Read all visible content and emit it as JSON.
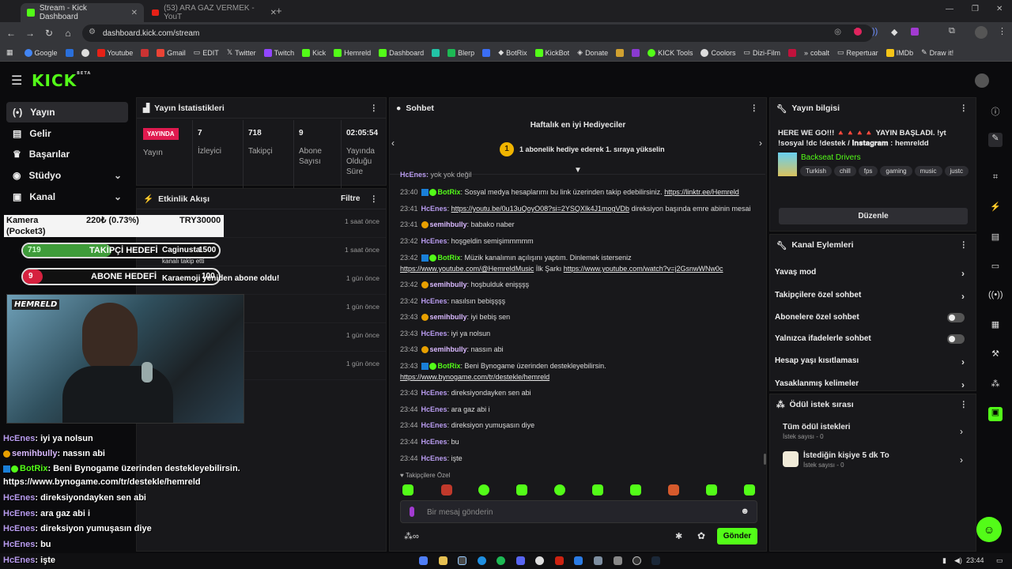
{
  "browser": {
    "tabs": [
      {
        "title": "Stream - Kick Dashboard",
        "active": true
      },
      {
        "title": "(53) ARA GAZ VERMEK - YouT",
        "active": false
      }
    ],
    "url": "dashboard.kick.com/stream",
    "bookmarks": [
      "Google",
      "",
      "",
      "Youtube",
      "",
      "Gmail",
      "EDIT",
      "Twitter",
      "Twitch",
      "Kick",
      "Hemreld",
      "Dashboard",
      "",
      "Blerp",
      "",
      "BotRix",
      "KickBot",
      "Donate",
      "",
      "",
      "KICK Tools",
      "Coolors",
      "Dizi-Film",
      "",
      "cobalt",
      "Repertuar",
      "IMDb",
      "Draw it!"
    ]
  },
  "logo": {
    "text": "KICK",
    "badge": "BETA"
  },
  "sidebar": {
    "items": [
      {
        "label": "Yayın",
        "icon": "broadcast-icon"
      },
      {
        "label": "Gelir",
        "icon": "money-icon"
      },
      {
        "label": "Başarılar",
        "icon": "trophy-icon"
      },
      {
        "label": "Stüdyo",
        "icon": "studio-icon"
      },
      {
        "label": "Kanal",
        "icon": "channel-icon"
      }
    ]
  },
  "stats": {
    "title": "Yayın İstatistikleri",
    "live_badge": "YAYINDA",
    "live_label": "Yayın",
    "viewers": "7",
    "viewers_label": "İzleyici",
    "followers": "718",
    "followers_label": "Takipçi",
    "subs": "9",
    "subs_label": "Abone Sayısı",
    "uptime": "02:05:54",
    "uptime_label": "Yayında Olduğu Süre"
  },
  "events": {
    "title": "Etkinlik Akışı",
    "filter": "Filtre",
    "rows": [
      {
        "time": "1 saat önce"
      },
      {
        "time": "1 saat önce"
      },
      {
        "time": "1 gün önce"
      },
      {
        "time": "1 gün önce"
      },
      {
        "time": "1 gün önce"
      },
      {
        "time": "1 gün önce"
      }
    ]
  },
  "overlay": {
    "donation_name": "Kamera (Pocket3)",
    "donation_amount": "220₺ (0.73%)",
    "donation_goal": "TRY30000",
    "follow_count": "719",
    "follow_goal_label": "TAKİPÇİ HEDEFİ",
    "follow_goal": "1500",
    "follow_user": "Caginusta",
    "follow_text": "kanalı takip etti",
    "sub_count": "9",
    "sub_goal_label": "ABONE HEDEFİ",
    "sub_goal": "100",
    "sub_event": "Karaemoji yeniden abone oldu!",
    "cam_logo": "HEMRELD",
    "chat": [
      {
        "user": "HcEnes",
        "text": ": iyi ya nolsun"
      },
      {
        "user": "semihbully",
        "text": ": nassın abi"
      },
      {
        "user": "BotRix",
        "text": ": Beni Bynogame üzerinden destekleyebilirsin."
      },
      {
        "user": "",
        "text": "https://www.bynogame.com/tr/destekle/hemreld"
      },
      {
        "user": "HcEnes",
        "text": ": direksiyondayken sen abi"
      },
      {
        "user": "HcEnes",
        "text": ": ara gaz abi i"
      },
      {
        "user": "HcEnes",
        "text": ": direksiyon yumuşasın diye"
      },
      {
        "user": "HcEnes",
        "text": ": bu"
      },
      {
        "user": "HcEnes",
        "text": ": işte"
      }
    ]
  },
  "chat": {
    "title": "Sohbet",
    "gifter_title": "Haftalık en iyi Hediyeciler",
    "gifter_text": "1 abonelik hediye ederek 1. sıraya yükselin",
    "gifter_rank": "1",
    "partial_top": "yok yok değil",
    "messages": [
      {
        "time": "23:40",
        "user": "BotRix",
        "text": "Sosyal medya hesaplarımı bu link üzerinden takip edebilirsiniz. ",
        "link": "https://linktr.ee/Hemreld",
        "type": "bot"
      },
      {
        "time": "23:41",
        "user": "HcEnes",
        "text": "",
        "link": "https://youtu.be/0u13uQoyO08?si=2YSQXlk4J1mogVDb",
        "tail": " direksiyon başında emre abinin mesai",
        "type": "hc"
      },
      {
        "time": "23:41",
        "user": "semihbully",
        "text": "babako naber",
        "type": "sb"
      },
      {
        "time": "23:42",
        "user": "HcEnes",
        "text": "hoşgeldin semişimmmmm",
        "type": "hc"
      },
      {
        "time": "23:42",
        "user": "BotRix",
        "text": "Müzik kanalımın açılışını yaptım. Dinlemek isterseniz",
        "link": "https://www.youtube.com/@HemreldMusic",
        "mid": " İlk Şarkı ",
        "link2": "https://www.youtube.com/watch?v=j2GsnwWNw0c",
        "type": "bot2"
      },
      {
        "time": "23:42",
        "user": "semihbully",
        "text": "hoşbulduk enişşşş",
        "type": "sb"
      },
      {
        "time": "23:42",
        "user": "HcEnes",
        "text": "nasılsın bebişşşş",
        "type": "hc"
      },
      {
        "time": "23:43",
        "user": "semihbully",
        "text": "iyi bebiş sen",
        "type": "sb"
      },
      {
        "time": "23:43",
        "user": "HcEnes",
        "text": "iyi ya nolsun",
        "type": "hc"
      },
      {
        "time": "23:43",
        "user": "semihbully",
        "text": "nassın abi",
        "type": "sb"
      },
      {
        "time": "23:43",
        "user": "BotRix",
        "text": "Beni Bynogame üzerinden destekleyebilirsin.",
        "link": "https://www.bynogame.com/tr/destekle/hemreld",
        "type": "bot3"
      },
      {
        "time": "23:43",
        "user": "HcEnes",
        "text": "direksiyondayken sen abi",
        "type": "hc"
      },
      {
        "time": "23:44",
        "user": "HcEnes",
        "text": "ara gaz abi i",
        "type": "hc"
      },
      {
        "time": "23:44",
        "user": "HcEnes",
        "text": "direksiyon yumuşasın diye",
        "type": "hc"
      },
      {
        "time": "23:44",
        "user": "HcEnes",
        "text": "bu",
        "type": "hc"
      },
      {
        "time": "23:44",
        "user": "HcEnes",
        "text": "işte",
        "type": "hc"
      }
    ],
    "follower_only": "Takipçilere Özel",
    "input_placeholder": "Bir mesaj gönderin",
    "send": "Gönder",
    "infinity": "∞"
  },
  "streaminfo": {
    "title": "Yayın bilgisi",
    "stream_title": "HERE WE GO!!! 🔺🔺🔺🔺 YAYIN BAŞLADI. !yt !sosyal !dc !destek / 𝐈𝐧𝐬𝐭𝐚𝐠𝐫𝐚𝐦 : hemreldd",
    "category": "Backseat Drivers",
    "tags": [
      "Turkish",
      "chill",
      "fps",
      "gaming",
      "music",
      "justc"
    ],
    "edit": "Düzenle"
  },
  "actions": {
    "title": "Kanal Eylemleri",
    "items": [
      {
        "label": "Yavaş mod",
        "kind": "chevron"
      },
      {
        "label": "Takipçilere özel sohbet",
        "kind": "chevron"
      },
      {
        "label": "Abonelere özel sohbet",
        "kind": "toggle"
      },
      {
        "label": "Yalnızca ifadelerle sohbet",
        "kind": "toggle"
      },
      {
        "label": "Hesap yaşı kısıtlaması",
        "kind": "chevron"
      },
      {
        "label": "Yasaklanmış kelimeler",
        "kind": "chevron"
      }
    ]
  },
  "rewards": {
    "title": "Ödül istek sırası",
    "items": [
      {
        "label": "Tüm ödül istekleri",
        "sub": "İstek sayısı - 0"
      },
      {
        "label": "İstediğin kişiye 5 dk To",
        "sub": "İstek sayısı - 0"
      }
    ]
  },
  "taskbar": {
    "time": "23:44"
  },
  "colors": {
    "accent": "#53fc18",
    "live": "#e01a4f",
    "panel": "#18181b"
  }
}
